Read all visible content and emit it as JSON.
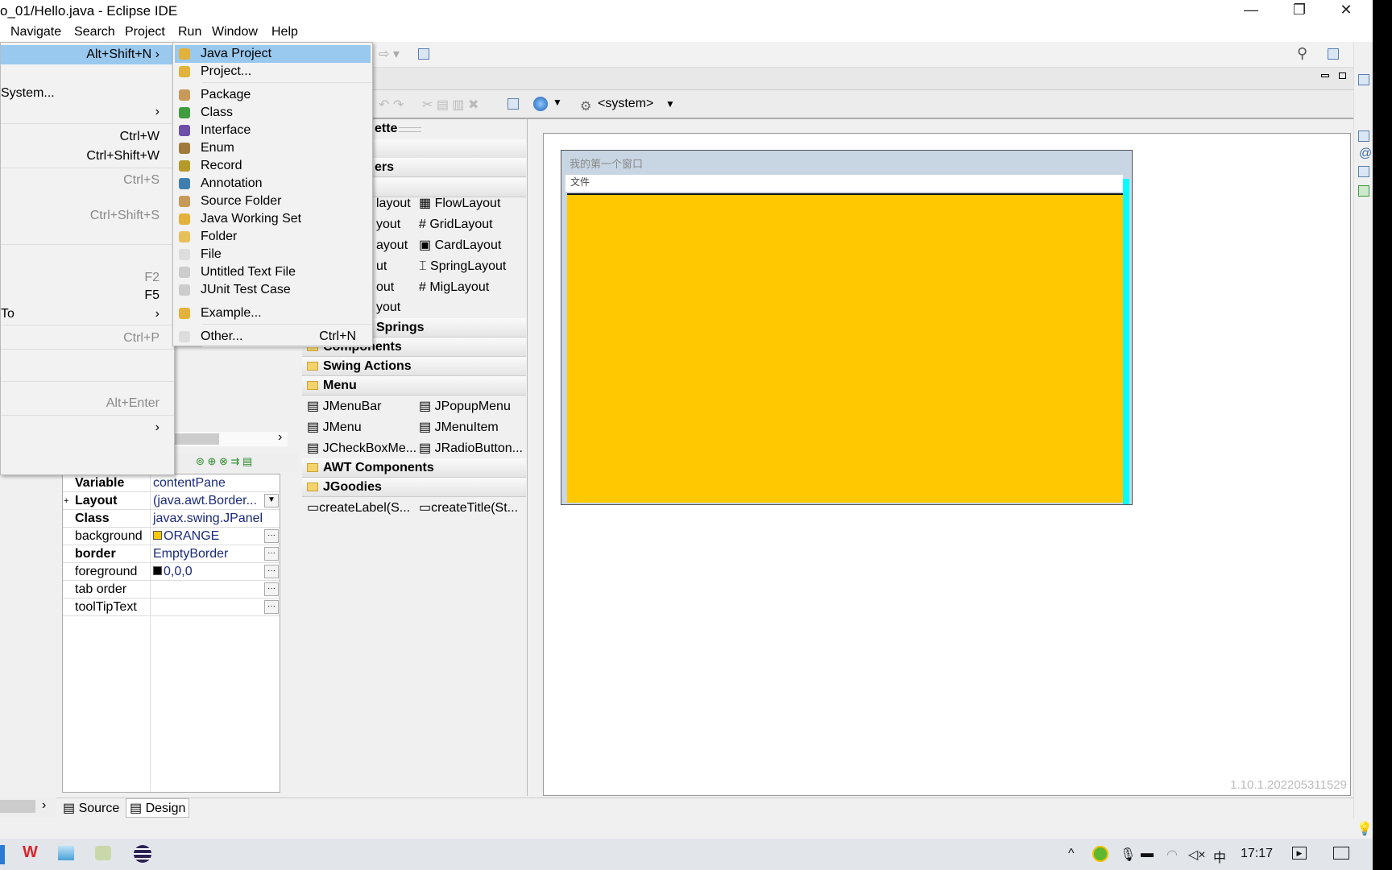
{
  "window": {
    "title": "o_01/Hello.java - Eclipse IDE",
    "minimize": "—",
    "restore": "❐",
    "close": "✕"
  },
  "menubar": [
    "Navigate",
    "Search",
    "Project",
    "Run",
    "Window",
    "Help"
  ],
  "file_menu": [
    {
      "shortcut": "Alt+Shift+N ›",
      "enabled": true
    },
    {
      "label": "System...",
      "enabled": true
    },
    {
      "shortcut": "›",
      "enabled": true
    },
    {
      "shortcut": "Ctrl+W",
      "enabled": true
    },
    {
      "shortcut": "Ctrl+Shift+W",
      "enabled": true
    },
    {
      "shortcut": "Ctrl+S",
      "enabled": false
    },
    {
      "shortcut": "Ctrl+Shift+S",
      "enabled": false
    },
    {
      "shortcut": "F2",
      "enabled": false
    },
    {
      "shortcut": "F5",
      "enabled": true
    },
    {
      "label": "To",
      "shortcut": "›",
      "enabled": true
    },
    {
      "shortcut": "Ctrl+P",
      "enabled": false
    },
    {
      "shortcut": "Alt+Enter",
      "enabled": false
    },
    {
      "shortcut": "›",
      "enabled": true
    }
  ],
  "new_submenu": [
    {
      "label": "Java Project",
      "icon": "java-project-icon",
      "selected": true
    },
    {
      "label": "Project...",
      "icon": "project-icon"
    },
    {
      "label": "Package",
      "icon": "package-icon"
    },
    {
      "label": "Class",
      "icon": "class-icon"
    },
    {
      "label": "Interface",
      "icon": "interface-icon"
    },
    {
      "label": "Enum",
      "icon": "enum-icon"
    },
    {
      "label": "Record",
      "icon": "record-icon"
    },
    {
      "label": "Annotation",
      "icon": "annotation-icon"
    },
    {
      "label": "Source Folder",
      "icon": "source-folder-icon"
    },
    {
      "label": "Java Working Set",
      "icon": "working-set-icon"
    },
    {
      "label": "Folder",
      "icon": "folder-icon"
    },
    {
      "label": "File",
      "icon": "file-icon"
    },
    {
      "label": "Untitled Text File",
      "icon": "text-file-icon"
    },
    {
      "label": "JUnit Test Case",
      "icon": "junit-icon"
    },
    {
      "label": "Example...",
      "icon": "example-icon"
    },
    {
      "label": "Other...",
      "shortcut": "Ctrl+N",
      "icon": "other-icon"
    }
  ],
  "editor_toolbar": {
    "system_combo": "<system>"
  },
  "palette": {
    "title": "ette",
    "section_partial": "ers",
    "layouts_left": [
      "layout",
      "yout",
      "ayout",
      "ut",
      "out",
      "yout"
    ],
    "layouts_right": [
      "FlowLayout",
      "GridLayout",
      "CardLayout",
      "SpringLayout",
      "MigLayout"
    ],
    "sections": [
      "Springs",
      "Components",
      "Swing Actions",
      "Menu",
      "AWT Components",
      "JGoodies"
    ],
    "menu_items": [
      "JMenuBar",
      "JPopupMenu",
      "JMenu",
      "JMenuItem",
      "JCheckBoxMe...",
      "JRadioButton..."
    ],
    "jgoodies_items": [
      "createLabel(S...",
      "createTitle(St..."
    ]
  },
  "design": {
    "frame_title": "我的第一个窗口",
    "frame_menu": "文件",
    "panel_color": "#ffc800",
    "version": "1.10.1.202205311529"
  },
  "properties": [
    {
      "name": "Variable",
      "value": "contentPane",
      "bold": true
    },
    {
      "name": "Layout",
      "value": "(java.awt.Border...",
      "bold": true,
      "expand": "+"
    },
    {
      "name": "Class",
      "value": "javax.swing.JPanel",
      "bold": true
    },
    {
      "name": "background",
      "value": "ORANGE",
      "swatch": "#ffc800"
    },
    {
      "name": "border",
      "value": "EmptyBorder",
      "bold": true
    },
    {
      "name": "foreground",
      "value": "0,0,0",
      "swatch": "#000000"
    },
    {
      "name": "tab order",
      "value": ""
    },
    {
      "name": "toolTipText",
      "value": ""
    }
  ],
  "bottom_tabs": [
    "Source",
    "Design"
  ],
  "taskbar": {
    "clock": "17:17",
    "ime": "中"
  }
}
